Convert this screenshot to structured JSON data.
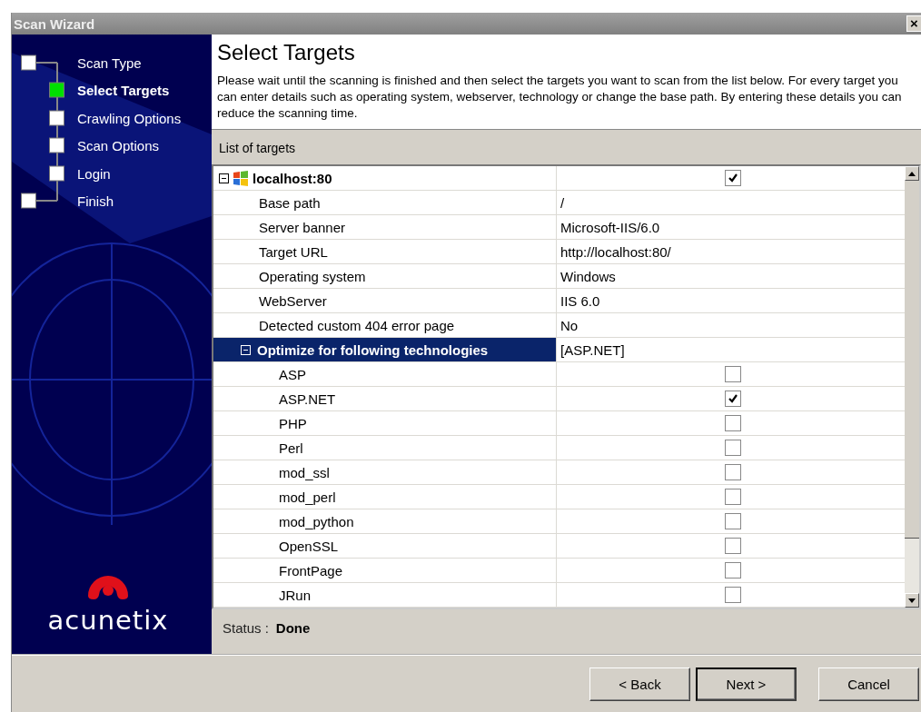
{
  "window": {
    "title": "Scan Wizard",
    "close": "×"
  },
  "steps": [
    {
      "label": "Scan Type",
      "selected": false
    },
    {
      "label": "Select Targets",
      "selected": true
    },
    {
      "label": "Crawling Options",
      "selected": false
    },
    {
      "label": "Scan Options",
      "selected": false
    },
    {
      "label": "Login",
      "selected": false
    },
    {
      "label": "Finish",
      "selected": false
    }
  ],
  "logo": {
    "text": "acunetix"
  },
  "header": {
    "title": "Select Targets",
    "description": "Please wait until the scanning is finished and then select the targets you want to scan from the list below. For every target you can enter details such as operating system, webserver, technology or change the base path. By entering these details you can reduce the scanning time."
  },
  "targets": {
    "caption": "List of targets",
    "tree": [
      {
        "name": "localhost:80",
        "checked": true,
        "expanded": true,
        "children": [
          {
            "kind": "property",
            "name": "Base path",
            "value": "/"
          },
          {
            "kind": "property",
            "name": "Server banner",
            "value": "Microsoft-IIS/6.0"
          },
          {
            "kind": "property",
            "name": "Target URL",
            "value": "http://localhost:80/"
          },
          {
            "kind": "property",
            "name": "Operating system",
            "value": "Windows"
          },
          {
            "kind": "property",
            "name": "WebServer",
            "value": "IIS 6.0"
          },
          {
            "kind": "property",
            "name": "Detected custom 404 error page",
            "value": "No"
          },
          {
            "kind": "group",
            "name": "Optimize for following technologies",
            "value": "[ASP.NET]",
            "selected": true,
            "expanded": true,
            "children": [
              {
                "name": "ASP",
                "checked": false
              },
              {
                "name": "ASP.NET",
                "checked": true
              },
              {
                "name": "PHP",
                "checked": false
              },
              {
                "name": "Perl",
                "checked": false
              },
              {
                "name": "mod_ssl",
                "checked": false
              },
              {
                "name": "mod_perl",
                "checked": false
              },
              {
                "name": "mod_python",
                "checked": false
              },
              {
                "name": "OpenSSL",
                "checked": false
              },
              {
                "name": "FrontPage",
                "checked": false
              },
              {
                "name": "JRun",
                "checked": false
              }
            ]
          }
        ]
      }
    ]
  },
  "status": {
    "label": "Status :",
    "value": "Done"
  },
  "buttons": [
    {
      "label": "< Back",
      "default": false
    },
    {
      "label": "Next >",
      "default": true
    },
    {
      "label": "Cancel",
      "default": false
    }
  ]
}
